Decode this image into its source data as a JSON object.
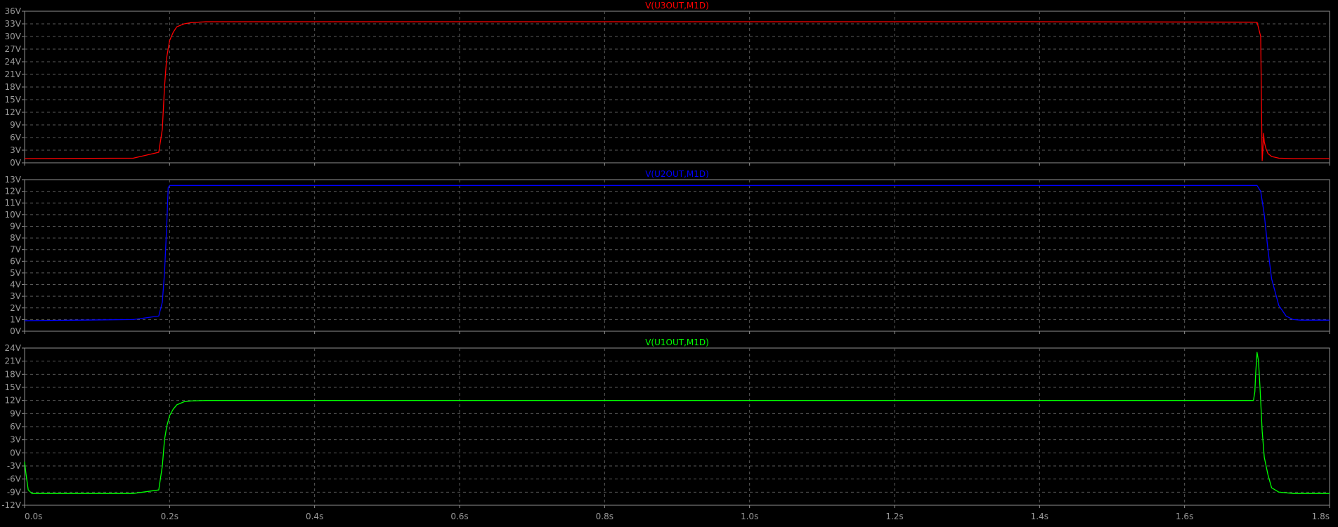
{
  "colors": {
    "background": "#000000",
    "frame": "#909090",
    "grid": "#5a5a5a",
    "tick_text": "#9a9a9a",
    "trace_1": "#ff0000",
    "trace_2": "#0000ff",
    "trace_3": "#00ff00"
  },
  "chart_data": [
    {
      "type": "line",
      "title": "V(U3OUT,M1D)",
      "title_color": "#ff0000",
      "ylim": [
        0,
        36
      ],
      "yticks": [
        0,
        3,
        6,
        9,
        12,
        15,
        18,
        21,
        24,
        27,
        30,
        33,
        36
      ],
      "ytick_labels": [
        "0V",
        "3V",
        "6V",
        "9V",
        "12V",
        "15V",
        "18V",
        "21V",
        "24V",
        "27V",
        "30V",
        "33V",
        "36V"
      ],
      "xlim": [
        0,
        1.8
      ],
      "grid": true,
      "series": [
        {
          "name": "V(U3OUT,M1D)",
          "color": "#ff0000",
          "x": [
            0,
            0.15,
            0.185,
            0.19,
            0.193,
            0.196,
            0.2,
            0.205,
            0.21,
            0.22,
            0.23,
            0.25,
            0.3,
            0.6,
            1.0,
            1.4,
            1.7,
            1.705,
            1.706,
            1.707,
            1.708,
            1.709,
            1.71,
            1.712,
            1.715,
            1.72,
            1.73,
            1.75,
            1.8
          ],
          "y": [
            1.0,
            1.1,
            2.5,
            8,
            18,
            25,
            29,
            31,
            32.3,
            33.0,
            33.3,
            33.5,
            33.5,
            33.5,
            33.5,
            33.5,
            33.4,
            30,
            15,
            0.5,
            3,
            7,
            5,
            3.5,
            2.2,
            1.5,
            1.1,
            1.0,
            1.0
          ]
        }
      ]
    },
    {
      "type": "line",
      "title": "V(U2OUT,M1D)",
      "title_color": "#0000ff",
      "ylim": [
        0,
        13
      ],
      "yticks": [
        0,
        1,
        2,
        3,
        4,
        5,
        6,
        7,
        8,
        9,
        10,
        11,
        12,
        13
      ],
      "ytick_labels": [
        "0V",
        "1V",
        "2V",
        "3V",
        "4V",
        "5V",
        "6V",
        "7V",
        "8V",
        "9V",
        "10V",
        "11V",
        "12V",
        "13V"
      ],
      "xlim": [
        0,
        1.8
      ],
      "grid": true,
      "series": [
        {
          "name": "V(U2OUT,M1D)",
          "color": "#0000ff",
          "x": [
            0,
            0.15,
            0.185,
            0.19,
            0.193,
            0.196,
            0.198,
            0.2,
            0.6,
            1.0,
            1.4,
            1.7,
            1.705,
            1.71,
            1.715,
            1.72,
            1.73,
            1.74,
            1.75,
            1.76,
            1.8
          ],
          "y": [
            0.9,
            1.0,
            1.3,
            2.5,
            5,
            9,
            12.3,
            12.5,
            12.5,
            12.5,
            12.5,
            12.5,
            12.0,
            10,
            7,
            4.5,
            2.2,
            1.3,
            1.0,
            0.95,
            0.95
          ]
        }
      ]
    },
    {
      "type": "line",
      "title": "V(U1OUT,M1D)",
      "title_color": "#00ff00",
      "ylim": [
        -12,
        24
      ],
      "yticks": [
        -12,
        -9,
        -6,
        -3,
        0,
        3,
        6,
        9,
        12,
        15,
        18,
        21,
        24
      ],
      "ytick_labels": [
        "-12V",
        "-9V",
        "-6V",
        "-3V",
        "0V",
        "3V",
        "6V",
        "9V",
        "12V",
        "15V",
        "18V",
        "21V",
        "24V"
      ],
      "xlim": [
        0,
        1.8
      ],
      "xticks": [
        0,
        0.2,
        0.4,
        0.6,
        0.8,
        1.0,
        1.2,
        1.4,
        1.6,
        1.8
      ],
      "xtick_labels": [
        "0.0s",
        "0.2s",
        "0.4s",
        "0.6s",
        "0.8s",
        "1.0s",
        "1.2s",
        "1.4s",
        "1.6s",
        "1.8s"
      ],
      "grid": true,
      "series": [
        {
          "name": "V(U1OUT,M1D)",
          "color": "#00ff00",
          "x": [
            0,
            0.002,
            0.005,
            0.01,
            0.15,
            0.185,
            0.19,
            0.193,
            0.196,
            0.2,
            0.205,
            0.21,
            0.22,
            0.23,
            0.25,
            0.3,
            0.6,
            1.0,
            1.4,
            1.695,
            1.697,
            1.698,
            1.7,
            1.702,
            1.704,
            1.707,
            1.71,
            1.715,
            1.72,
            1.73,
            1.75,
            1.8
          ],
          "y": [
            -2,
            -5,
            -8.5,
            -9.3,
            -9.3,
            -8.5,
            -3,
            3,
            6,
            8.5,
            10,
            11,
            11.7,
            11.9,
            12,
            12,
            12,
            12,
            12,
            12,
            14,
            18,
            23,
            21,
            15,
            5,
            -1,
            -5,
            -8,
            -9,
            -9.3,
            -9.3
          ]
        }
      ]
    }
  ]
}
